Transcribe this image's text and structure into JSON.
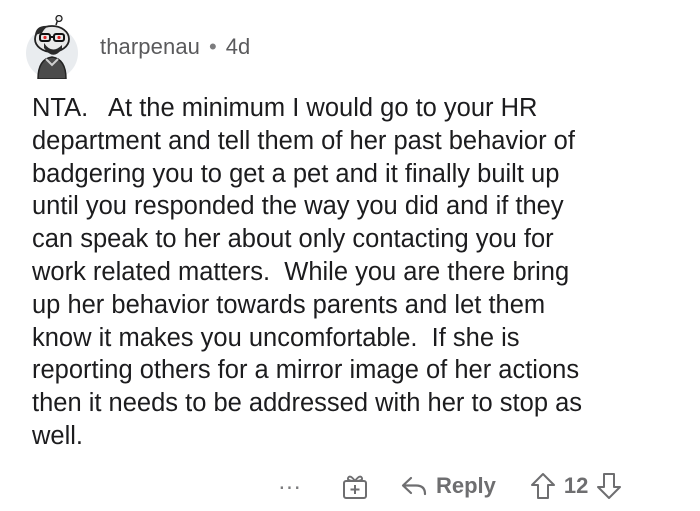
{
  "comment": {
    "username": "tharpenau",
    "separator": "•",
    "age": "4d",
    "text": "NTA.   At the minimum I would go to your HR\ndepartment and tell them of her past behavior of\nbadgering you to get a pet and it finally built up\nuntil you responded the way you did and if they\ncan speak to her about only contacting you for\nwork related matters.  While you are there bring\nup her behavior towards parents and let them\nknow it makes you uncomfortable.  If she is\nreporting others for a mirror image of her actions\nthen it needs to be addressed with her to stop as\nwell."
  },
  "actions": {
    "more_label": "...",
    "award_icon": "gift-box-icon",
    "reply_label": "Reply",
    "reply_icon": "reply-arrow-icon",
    "score": "12",
    "upvote_icon": "upvote-arrow-icon",
    "downvote_icon": "downvote-arrow-icon"
  },
  "colors": {
    "text": "#1c1c1e",
    "meta": "#5a5a5c",
    "icon": "#6e6e70",
    "background": "#ffffff"
  }
}
